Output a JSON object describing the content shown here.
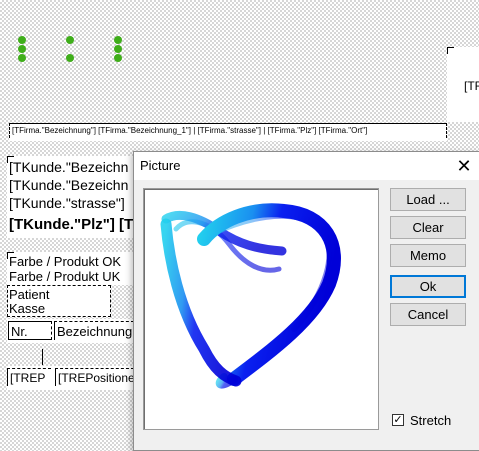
{
  "report": {
    "company_header": "[TFirma.\"Bezeichnung\"] [TFirma.\"Bezeichnung_1\"] | [TFirma.\"strasse\"] | [TFirma.\"Plz\"] [TFirma.\"Ort\"]",
    "right_field": "[TF",
    "customer_lines": [
      "[TKunde.\"Bezeichn",
      "[TKunde.\"Bezeichn",
      "[TKunde.\"strasse\"]"
    ],
    "customer_bold": "[TKunde.\"Plz\"] [T",
    "color_ok": "Farbe / Produkt OK",
    "color_uk": "Farbe / Produkt UK",
    "patient_label": "Patient",
    "kasse_label": "Kasse",
    "col_nr": "Nr.",
    "col_bezeichnung": "Bezeichnung",
    "trep": "[TREP",
    "trepositione": "[TREPositione"
  },
  "dialog": {
    "title": "Picture",
    "close_glyph": "✕",
    "buttons": {
      "load": "Load ...",
      "clear": "Clear",
      "memo": "Memo",
      "ok": "Ok",
      "cancel": "Cancel"
    },
    "stretch_label": "Stretch",
    "stretch_checked": true,
    "check_glyph": "✓"
  },
  "colors": {
    "accent_blue": "#0000e0",
    "accent_cyan": "#1ec8e8",
    "dot_green": "#3fae1a",
    "default_button_border": "#0078d7"
  }
}
